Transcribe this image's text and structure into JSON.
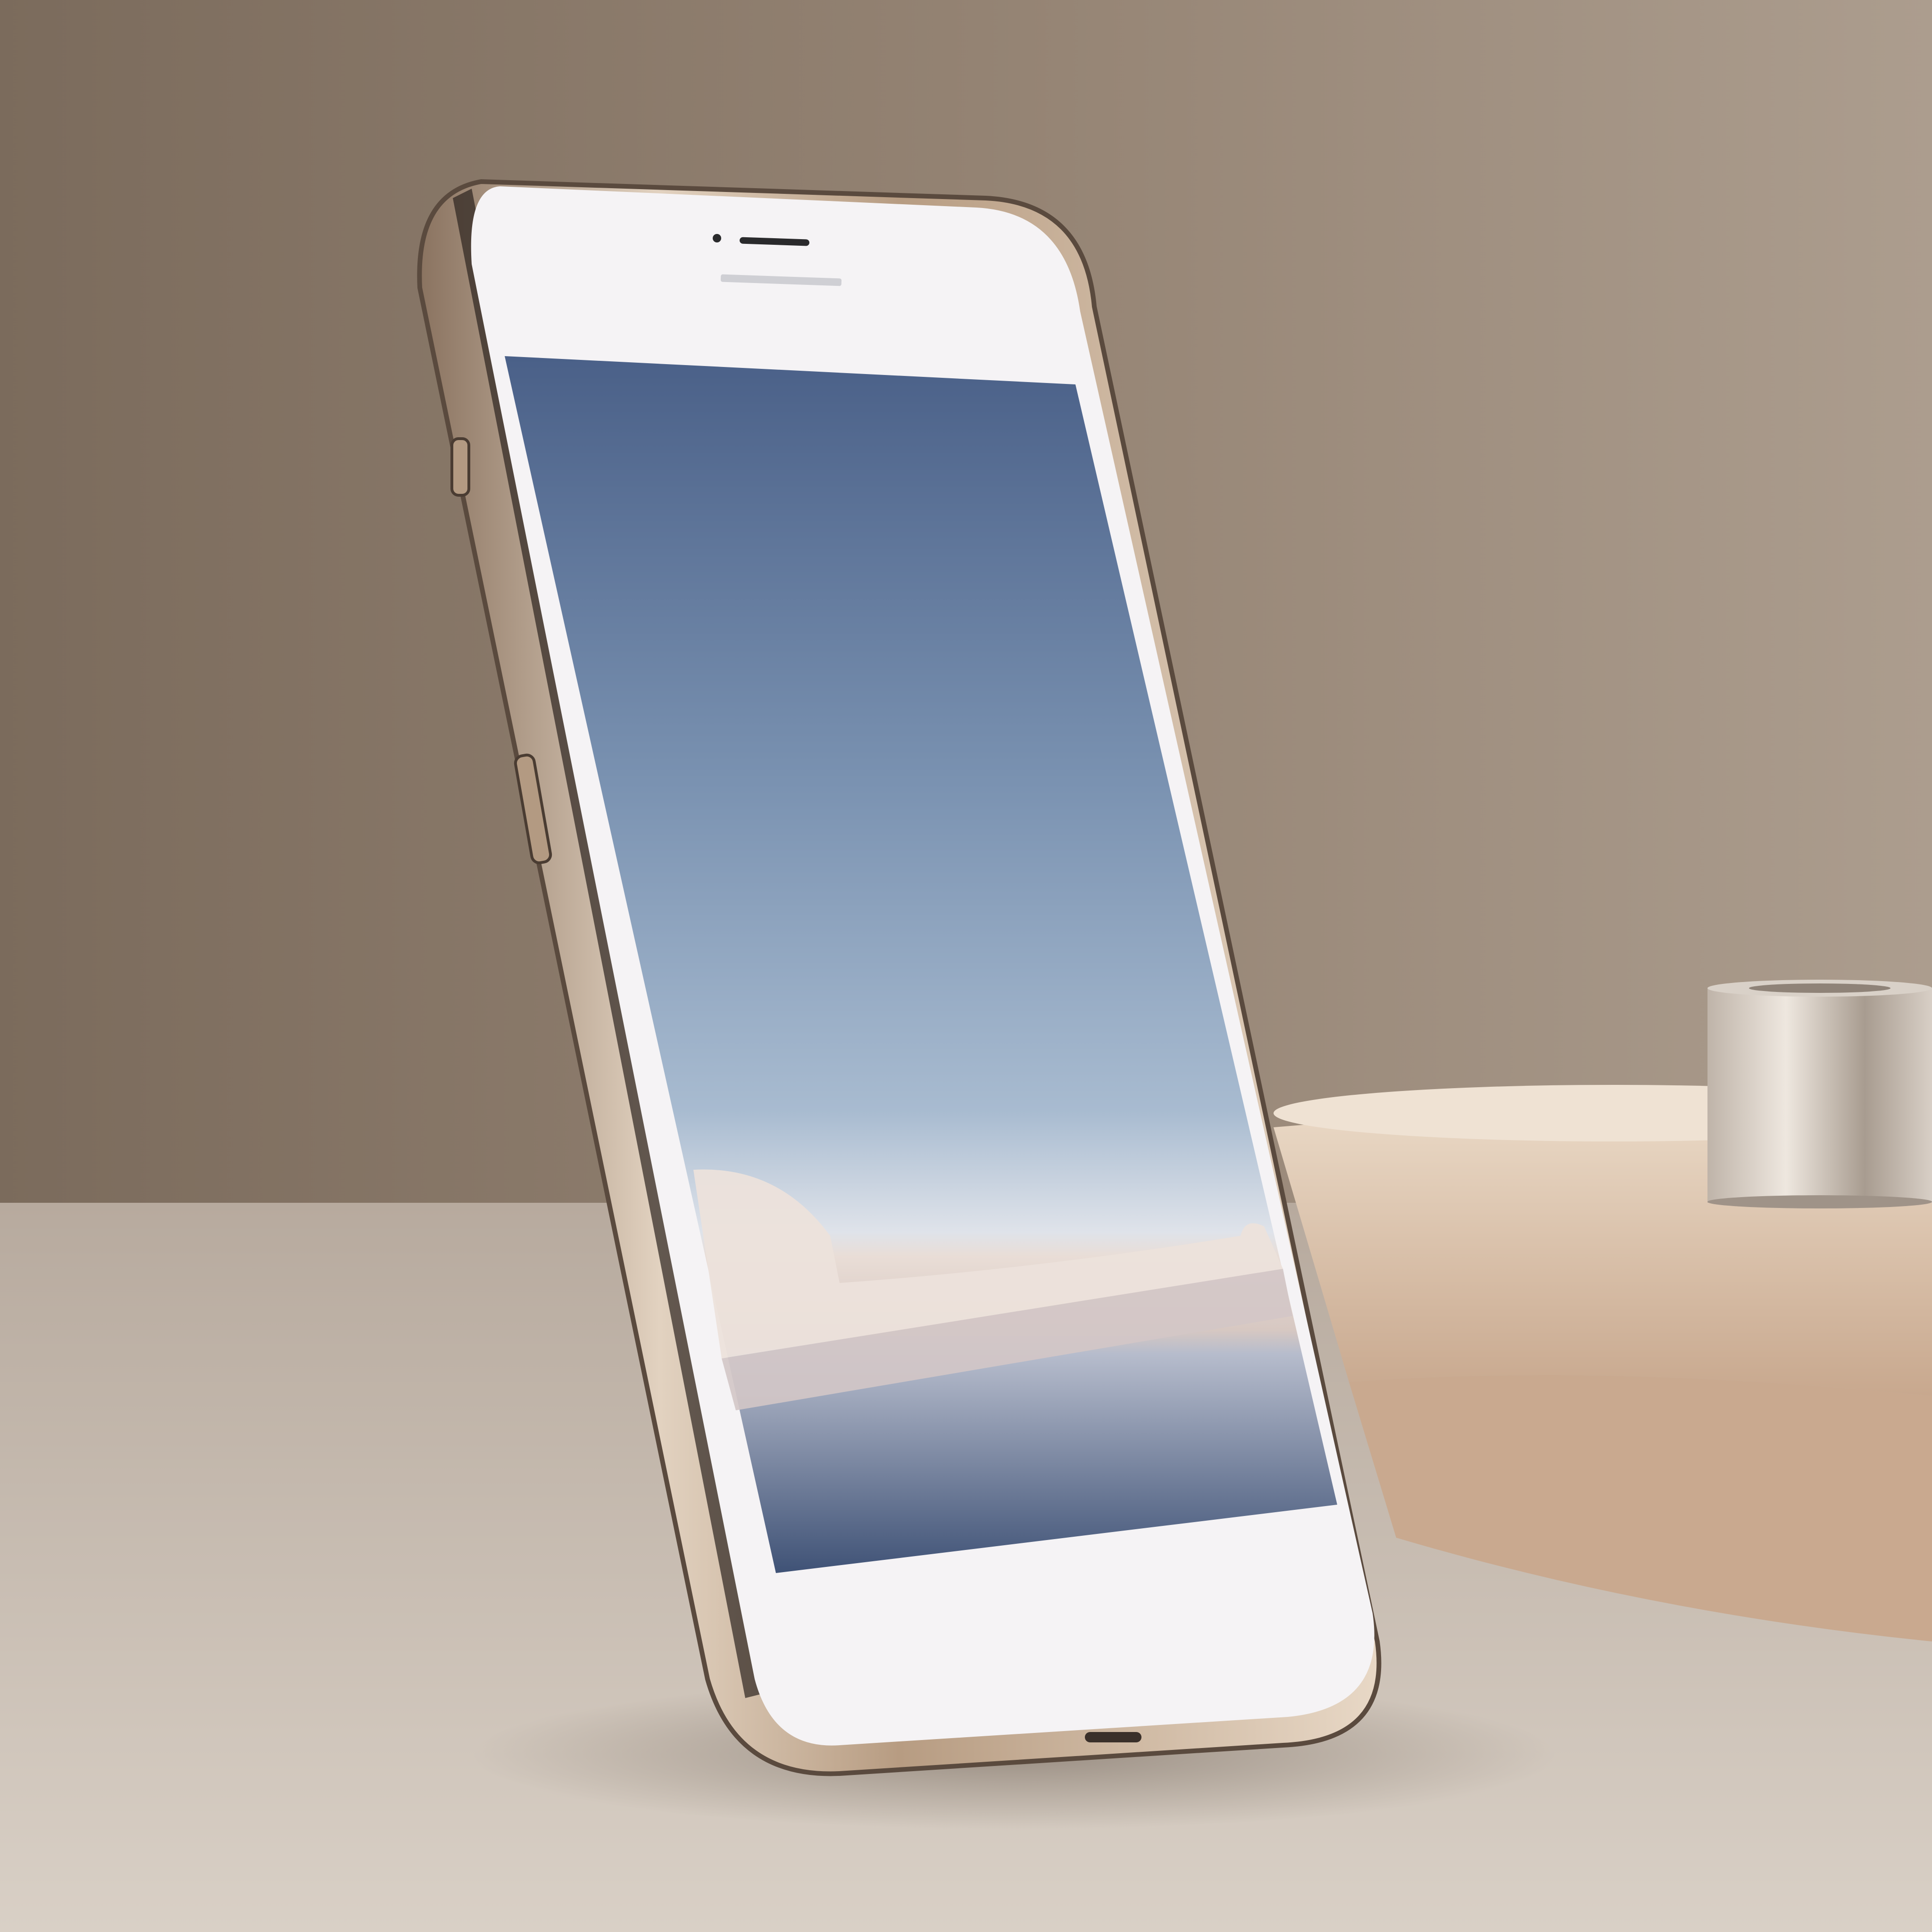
{
  "scene": {
    "subject": "smartphone",
    "colors": {
      "wall_dark": "#7d6d5e",
      "wall_light": "#a8998a",
      "floor_back": "#b8aca0",
      "floor_front": "#d6cdc2",
      "phone_frame": "#c9b49c",
      "phone_front": "#f4f2f4",
      "screen_top": "#4a6088",
      "screen_mid": "#9fb4cb",
      "screen_horizon": "#dfe3ea",
      "dune": "#e8ddd6",
      "water": "#97a5bf",
      "pedestal": "#e3cfbb",
      "pedestal_side": "#c9a98f",
      "metal": "#cfc5bb"
    },
    "icons": [
      "speaker-grille-icon",
      "front-camera-icon",
      "charging-port-icon",
      "side-button-icon"
    ]
  }
}
